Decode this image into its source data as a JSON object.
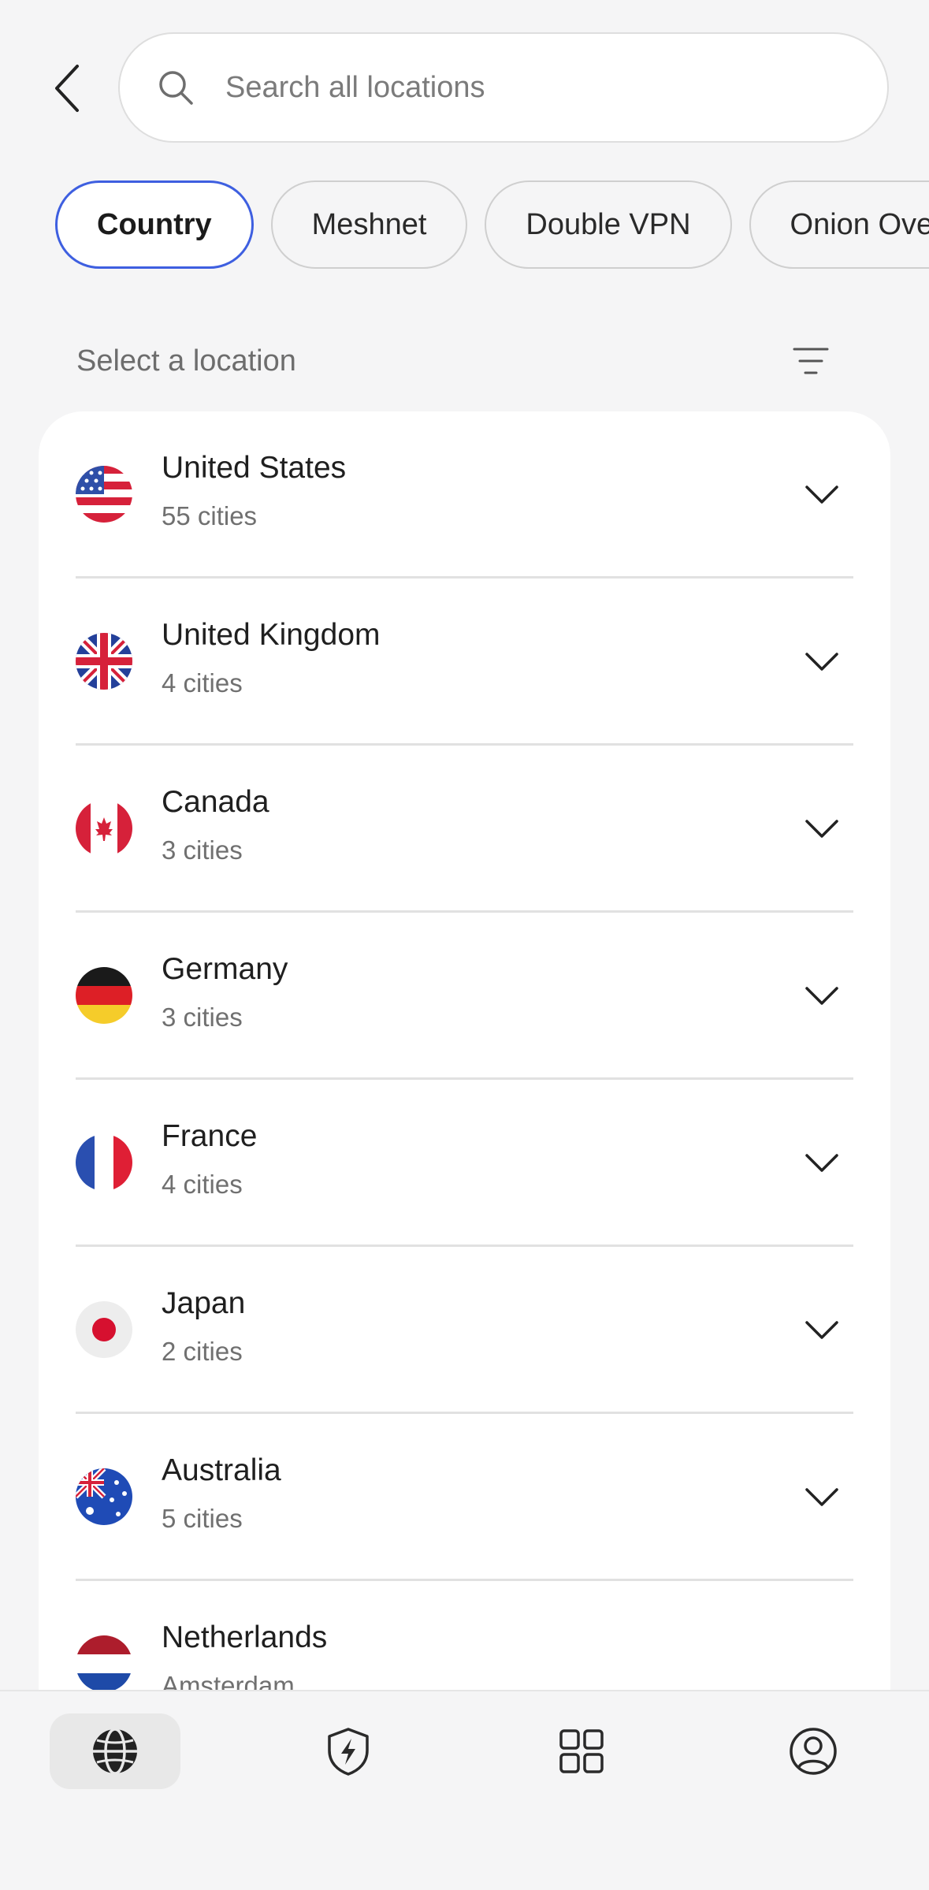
{
  "search": {
    "placeholder": "Search all locations"
  },
  "chips": [
    {
      "label": "Country",
      "active": true
    },
    {
      "label": "Meshnet",
      "active": false
    },
    {
      "label": "Double VPN",
      "active": false
    },
    {
      "label": "Onion Over VPN",
      "active": false
    }
  ],
  "section": {
    "label": "Select a location"
  },
  "locations": [
    {
      "name": "United States",
      "sub": "55 cities"
    },
    {
      "name": "United Kingdom",
      "sub": "4 cities"
    },
    {
      "name": "Canada",
      "sub": "3 cities"
    },
    {
      "name": "Germany",
      "sub": "3 cities"
    },
    {
      "name": "France",
      "sub": "4 cities"
    },
    {
      "name": "Japan",
      "sub": "2 cities"
    },
    {
      "name": "Australia",
      "sub": "5 cities"
    },
    {
      "name": "Netherlands",
      "sub": "Amsterdam"
    }
  ],
  "nav": [
    {
      "icon": "globe-icon",
      "active": true
    },
    {
      "icon": "shield-bolt-icon",
      "active": false
    },
    {
      "icon": "grid-icon",
      "active": false
    },
    {
      "icon": "profile-icon",
      "active": false
    }
  ],
  "colors": {
    "accent": "#3e5fe0",
    "background": "#f5f5f6"
  }
}
